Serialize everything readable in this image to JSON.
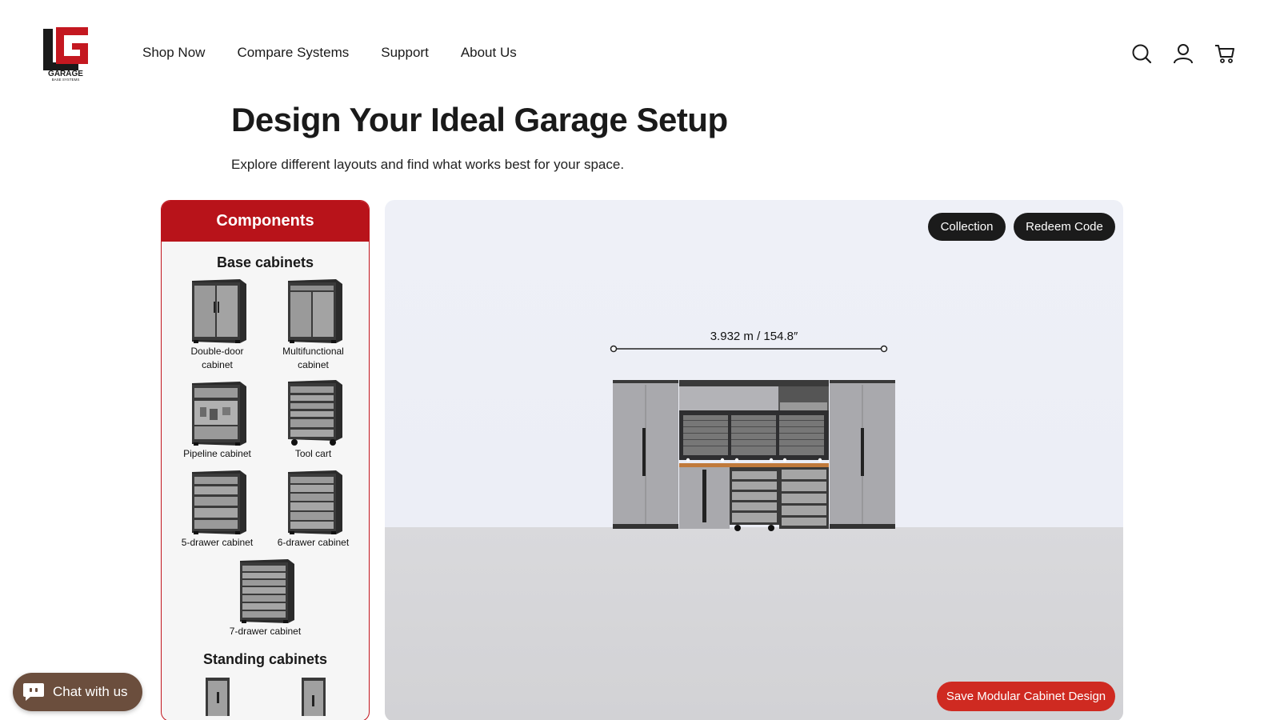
{
  "brand": {
    "logo_text": "GARAGE",
    "logo_subtext": "BASE SYSTEMS",
    "logo_color": "#c41820"
  },
  "nav": {
    "items": [
      {
        "label": "Shop Now"
      },
      {
        "label": "Compare Systems"
      },
      {
        "label": "Support"
      },
      {
        "label": "About Us"
      }
    ]
  },
  "header_icons": [
    "search-icon",
    "account-icon",
    "cart-icon"
  ],
  "page": {
    "title": "Design Your Ideal Garage Setup",
    "subtitle": "Explore different layouts and find what works best for your space."
  },
  "components": {
    "header": "Components",
    "base_title": "Base cabinets",
    "base_items": [
      {
        "label": "Double-door cabinet"
      },
      {
        "label": "Multifunctional cabinet"
      },
      {
        "label": "Pipeline cabinet"
      },
      {
        "label": "Tool cart"
      },
      {
        "label": "5-drawer cabinet"
      },
      {
        "label": "6-drawer cabinet"
      },
      {
        "label": "7-drawer cabinet"
      }
    ],
    "standing_title": "Standing cabinets"
  },
  "viewer": {
    "collection_label": "Collection",
    "redeem_label": "Redeem Code",
    "dimension": "3.932 m / 154.8″",
    "save_label": "Save Modular Cabinet Design"
  },
  "chat": {
    "label": "Chat with us",
    "color": "#6b4e3d"
  },
  "colors": {
    "accent_red": "#b8131a",
    "save_red": "#cf2a21",
    "dark_button": "#1b1b1b"
  }
}
